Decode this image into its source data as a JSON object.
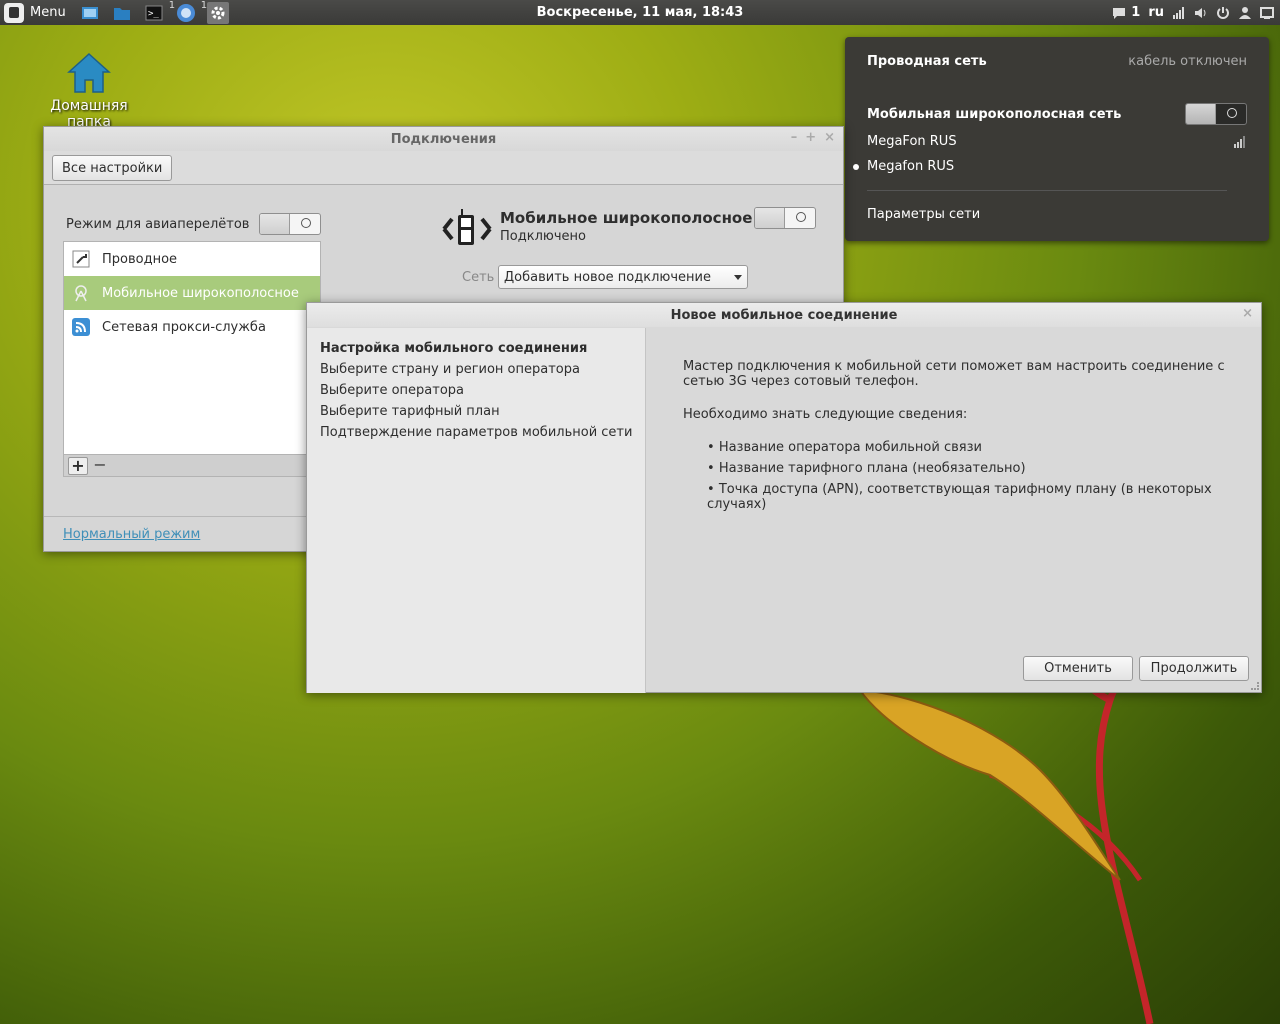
{
  "panel": {
    "menu_label": "Menu",
    "launcher_badges": [
      "1",
      "1"
    ],
    "clock": "Воскресенье, 11 мая, 18:43",
    "tray": {
      "notifications_count": "1",
      "keyboard_layout": "ru"
    }
  },
  "desktop": {
    "home_label": "Домашняя папка"
  },
  "net_popup": {
    "wired_label": "Проводная сеть",
    "wired_status": "кабель отключен",
    "mobile_label": "Мобильная широкополосная сеть",
    "networks": [
      {
        "name": "MegaFon RUS"
      },
      {
        "name": "Megafon RUS"
      }
    ],
    "settings_link": "Параметры сети"
  },
  "connections_window": {
    "title": "Подключения",
    "all_settings_button": "Все настройки",
    "airplane_mode_label": "Режим для авиаперелётов",
    "interfaces": [
      {
        "label": "Проводное"
      },
      {
        "label": "Мобильное широкополосное"
      },
      {
        "label": "Сетевая прокси-служба"
      }
    ],
    "mobile_title": "Мобильное широкополосное",
    "mobile_status": "Подключено",
    "network_label": "Сеть",
    "network_value": "Добавить новое подключение",
    "normal_mode_link": "Нормальный режим"
  },
  "new_connection_dialog": {
    "title": "Новое мобильное соединение",
    "steps": [
      "Настройка мобильного соединения",
      "Выберите страну и регион оператора",
      "Выберите оператора",
      "Выберите тарифный план",
      "Подтверждение параметров мобильной сети"
    ],
    "intro": "Мастер подключения к мобильной сети поможет вам настроить соединение с сетью 3G через сотовый телефон.",
    "info_heading": "Необходимо знать следующие сведения:",
    "requirements": [
      "Название оператора мобильной связи",
      "Название тарифного плана (необязательно)",
      "Точка доступа (APN), соответствующая тарифному плану (в некоторых случаях)"
    ],
    "cancel_button": "Отменить",
    "continue_button": "Продолжить"
  },
  "colors": {
    "selection": "#a8cb7c",
    "link": "#3f8fb8",
    "popup_bg": "#3b3a36",
    "panel_bg": "#3a3a38"
  }
}
